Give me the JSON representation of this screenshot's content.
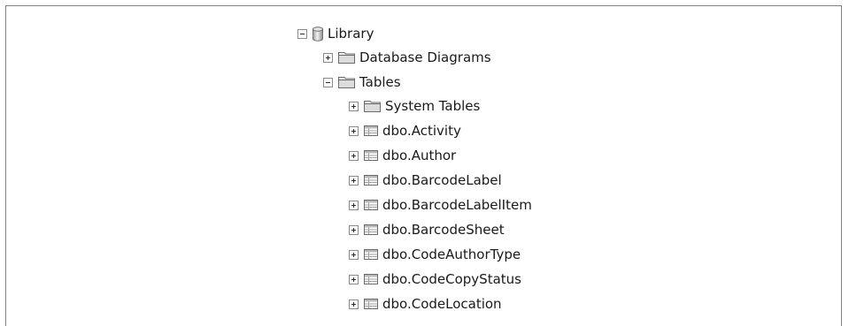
{
  "object_explorer": {
    "root": {
      "label": "Library",
      "icon": "database-icon",
      "expanded": true
    },
    "root_children": [
      {
        "label": "Database Diagrams",
        "icon": "folder-icon",
        "expanded": false
      },
      {
        "label": "Tables",
        "icon": "folder-icon",
        "expanded": true
      }
    ],
    "tables": [
      {
        "label": "System Tables",
        "icon": "folder-icon",
        "expanded": false
      },
      {
        "label": "dbo.Activity",
        "icon": "table-icon",
        "expanded": false
      },
      {
        "label": "dbo.Author",
        "icon": "table-icon",
        "expanded": false
      },
      {
        "label": "dbo.BarcodeLabel",
        "icon": "table-icon",
        "expanded": false
      },
      {
        "label": "dbo.BarcodeLabelItem",
        "icon": "table-icon",
        "expanded": false
      },
      {
        "label": "dbo.BarcodeSheet",
        "icon": "table-icon",
        "expanded": false
      },
      {
        "label": "dbo.CodeAuthorType",
        "icon": "table-icon",
        "expanded": false
      },
      {
        "label": "dbo.CodeCopyStatus",
        "icon": "table-icon",
        "expanded": false
      },
      {
        "label": "dbo.CodeLocation",
        "icon": "table-icon",
        "expanded": false
      }
    ]
  }
}
